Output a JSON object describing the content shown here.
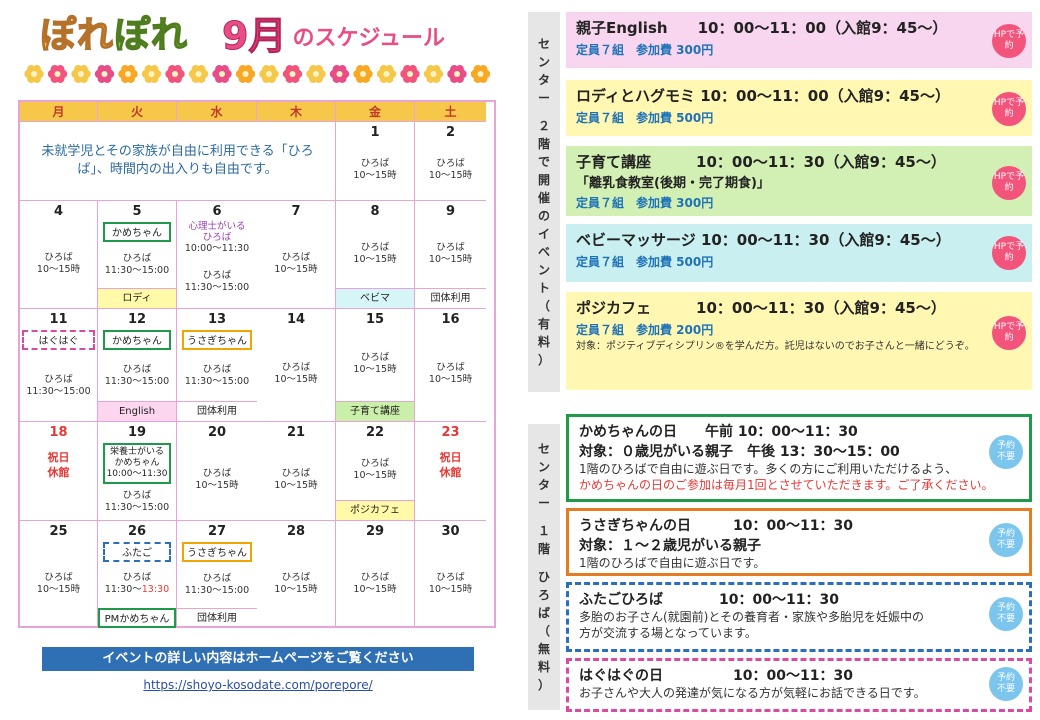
{
  "header": {
    "logo_part1": "ぽれ",
    "logo_part2": "ぽれ",
    "month": "9月",
    "subtitle": "のスケジュール"
  },
  "calendar": {
    "weekdays": [
      "月",
      "火",
      "水",
      "木",
      "金",
      "土"
    ],
    "intro": "未就学児とその家族が自由に利用できる「ひろば」、時間内の出入りも自由です。",
    "hiroba": "ひろば",
    "hiroba_time": "10〜15時",
    "hiroba_time_tue": "11:30〜15:00",
    "week1": {
      "fri": "1",
      "sat": "2"
    },
    "week2": {
      "mon": "4",
      "tue": "5",
      "wed": "6",
      "thu": "7",
      "fri": "8",
      "sat": "9",
      "tue_tag": "かめちゃん",
      "tue_foot": "ロディ",
      "wed_tag": "心理士がいるひろば",
      "wed_time": "10:00〜11:30",
      "fri_foot": "ベビマ",
      "sat_foot": "団体利用"
    },
    "week3": {
      "mon": "11",
      "tue": "12",
      "wed": "13",
      "thu": "14",
      "fri": "15",
      "sat": "16",
      "mon_tag": "はぐはぐ",
      "mon_time": "11:30〜15:00",
      "tue_tag": "かめちゃん",
      "tue_foot": "English",
      "wed_tag": "うさぎちゃん",
      "wed_foot": "団体利用",
      "fri_foot": "子育て講座"
    },
    "week4": {
      "mon": "18",
      "tue": "19",
      "wed": "20",
      "thu": "21",
      "fri": "22",
      "sat": "23",
      "holiday": "祝日休館",
      "tue_box_line1": "栄養士がいる",
      "tue_box_line2": "かめちゃん",
      "tue_box_line3": "10:00〜11:30",
      "fri_foot": "ポジカフェ"
    },
    "week5": {
      "mon": "25",
      "tue": "26",
      "wed": "27",
      "thu": "28",
      "fri": "29",
      "sat": "30",
      "tue_tag": "ふたご",
      "tue_time_a": "11:30〜",
      "tue_time_b": "13:30",
      "tue_foot": "PMかめちゃん",
      "wed_tag": "うさぎちゃん",
      "wed_foot": "団体利用"
    }
  },
  "banner": "イベントの詳しい内容はホームページをご覧ください",
  "url": "https://shoyo-kosodate.com/porepore/",
  "side_labels": {
    "floor2": [
      "セ",
      "ン",
      "タ",
      "ー",
      "",
      "２",
      "階",
      "で",
      "開",
      "催",
      "の",
      "イ",
      "ベ",
      "ン",
      "ト",
      "（",
      "有",
      "料",
      "）"
    ],
    "floor1": [
      "セ",
      "ン",
      "タ",
      "ー",
      "",
      "１",
      "階",
      "",
      "ひ",
      "ろ",
      "ば",
      "（",
      "無",
      "料",
      "）"
    ]
  },
  "events": [
    {
      "title": "親子English",
      "time": "10：00〜11：00（入館9：45〜）",
      "cap": "定員７組　参加費 300円",
      "badge": "HPで予約"
    },
    {
      "title": "ロディとハグモミ",
      "time": "10：00〜11：00（入館9：45〜）",
      "cap": "定員７組　参加費 500円",
      "badge": "HPで予約"
    },
    {
      "title": "子育て講座",
      "time": "10：00〜11：30（入館9：45〜）",
      "sub": "「離乳食教室(後期・完了期食)」",
      "cap": "定員７組　参加費 300円",
      "badge": "HPで予約"
    },
    {
      "title": "ベビーマッサージ",
      "time": "10：00〜11：30（入館9：45〜）",
      "cap": "定員７組　参加費 500円",
      "badge": "HPで予約"
    },
    {
      "title": "ポジカフェ",
      "time": "10：00〜11：30（入館9：45〜）",
      "cap": "定員７組　参加費 200円",
      "note": "対象：ポジティブディシプリン®を学んだ方。託児はないのでお子さんと一緒にどうぞ。",
      "badge": "HPで予約"
    }
  ],
  "hiroba_events": [
    {
      "title": "かめちゃんの日",
      "time": "午前 10：00〜11：30",
      "target": "対象：０歳児がいる親子",
      "time2": "午後 13：30〜15：00",
      "line1": "1階のひろばで自由に遊ぶ日です。多くの方にご利用いただけるよう、",
      "line2": "かめちゃんの日のご参加は毎月1回とさせていただきます。ご了承ください。",
      "badge": "予約不要"
    },
    {
      "title": "うさぎちゃんの日",
      "time": "10：00〜11：30",
      "target": "対象：１〜２歳児がいる親子",
      "line1": "1階のひろばで自由に遊ぶ日です。",
      "badge": "予約不要"
    },
    {
      "title": "ふたごひろば",
      "time": "10：00〜11：30",
      "line1": "多胎のお子さん(就園前)とその養育者・家族や多胎児を妊娠中の",
      "line2": "方が交流する場となっています。",
      "badge": "予約不要"
    },
    {
      "title": "はぐはぐの日",
      "time": "10：00〜11：30",
      "line1": "お子さんや大人の発達が気になる方が気軽にお話できる日です。",
      "badge": "予約不要"
    }
  ],
  "colors": {
    "accent_pink": "#e84d87",
    "calendar_border": "#e8a4d6",
    "header_yellow": "#f6c84a",
    "link_blue": "#2f6fb3"
  }
}
